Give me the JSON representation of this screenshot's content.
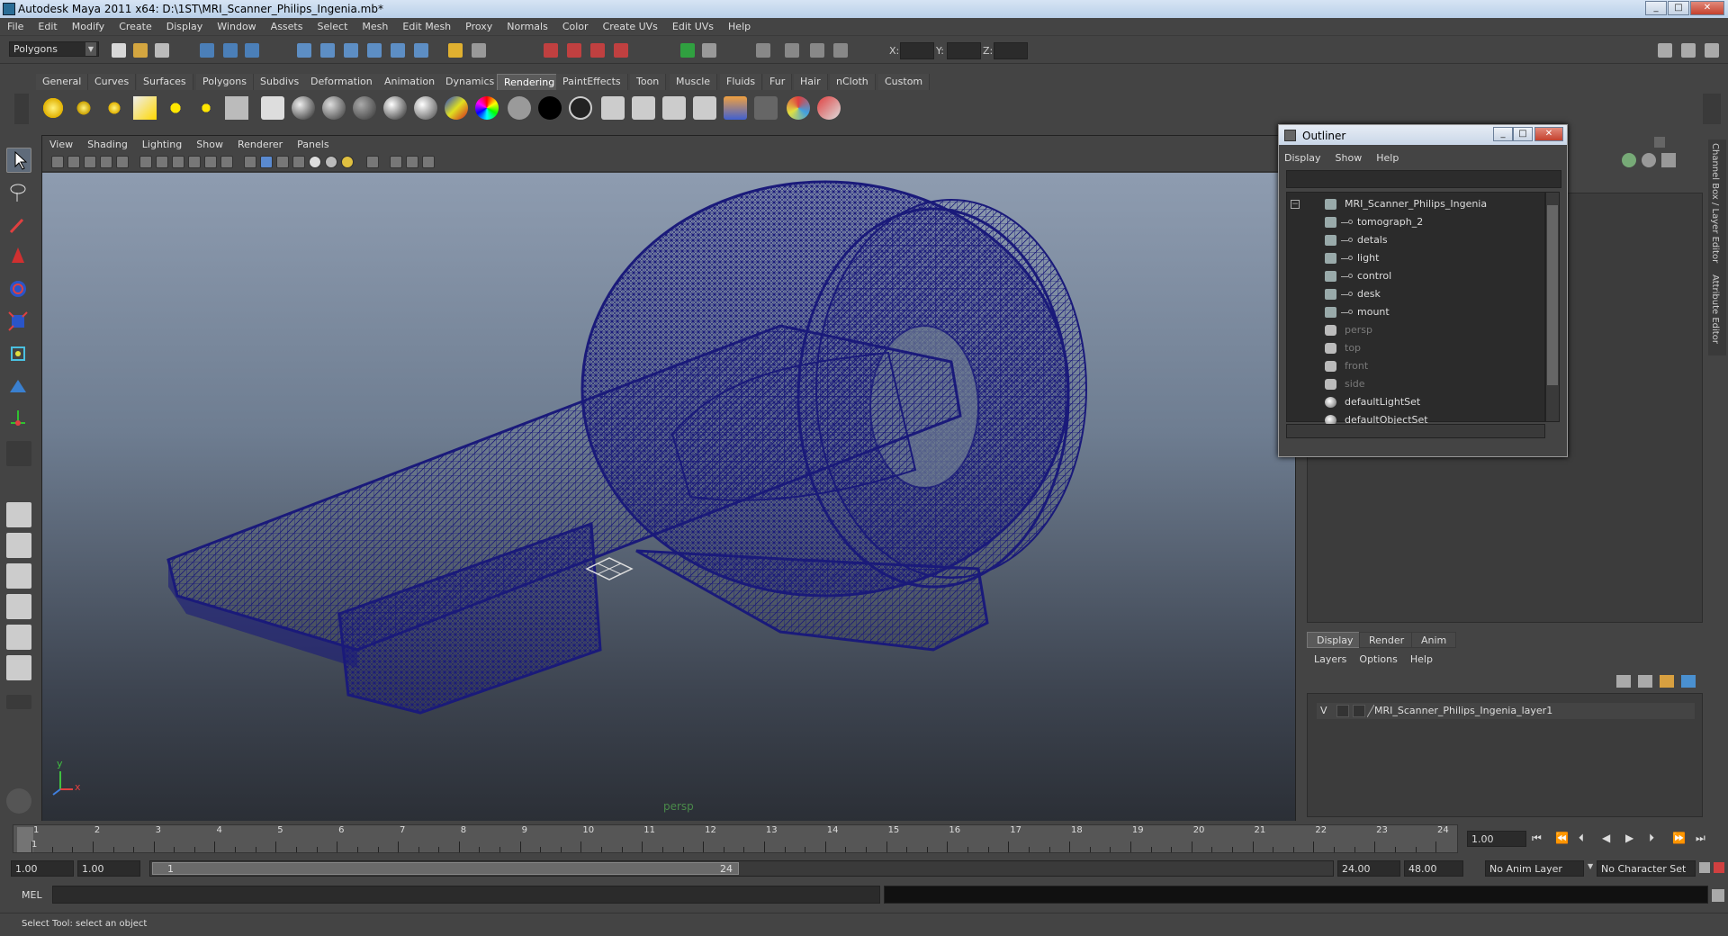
{
  "window": {
    "title": "Autodesk Maya 2011 x64: D:\\1ST\\MRI_Scanner_Philips_Ingenia.mb*"
  },
  "menubar": [
    "File",
    "Edit",
    "Modify",
    "Create",
    "Display",
    "Window",
    "Assets",
    "Select",
    "Mesh",
    "Edit Mesh",
    "Proxy",
    "Normals",
    "Color",
    "Create UVs",
    "Edit UVs",
    "Help"
  ],
  "statusline": {
    "menuset": "Polygons",
    "x_label": "X:",
    "y_label": "Y:",
    "z_label": "Z:"
  },
  "shelf": {
    "tabs": [
      "General",
      "Curves",
      "Surfaces",
      "Polygons",
      "Subdivs",
      "Deformation",
      "Animation",
      "Dynamics",
      "Rendering",
      "PaintEffects",
      "Toon",
      "Muscle",
      "Fluids",
      "Fur",
      "Hair",
      "nCloth",
      "Custom"
    ],
    "active_tab": "Rendering"
  },
  "viewport": {
    "menu": [
      "View",
      "Shading",
      "Lighting",
      "Show",
      "Renderer",
      "Panels"
    ],
    "camera_label": "persp",
    "axis_y": "y",
    "axis_x": "x",
    "wire_color": "#1a1a7a"
  },
  "outliner": {
    "title": "Outliner",
    "menu": [
      "Display",
      "Show",
      "Help"
    ],
    "items": [
      {
        "label": "MRI_Scanner_Philips_Ingenia",
        "indent": 0,
        "kind": "group",
        "dim": false
      },
      {
        "label": "tomograph_2",
        "indent": 1,
        "kind": "mesh",
        "dim": false
      },
      {
        "label": "detals",
        "indent": 1,
        "kind": "mesh",
        "dim": false
      },
      {
        "label": "light",
        "indent": 1,
        "kind": "mesh",
        "dim": false
      },
      {
        "label": "control",
        "indent": 1,
        "kind": "mesh",
        "dim": false
      },
      {
        "label": "desk",
        "indent": 1,
        "kind": "mesh",
        "dim": false
      },
      {
        "label": "mount",
        "indent": 1,
        "kind": "mesh",
        "dim": false
      },
      {
        "label": "persp",
        "indent": 0,
        "kind": "camera",
        "dim": true
      },
      {
        "label": "top",
        "indent": 0,
        "kind": "camera",
        "dim": true
      },
      {
        "label": "front",
        "indent": 0,
        "kind": "camera",
        "dim": true
      },
      {
        "label": "side",
        "indent": 0,
        "kind": "camera",
        "dim": true
      },
      {
        "label": "defaultLightSet",
        "indent": 0,
        "kind": "set",
        "dim": false
      },
      {
        "label": "defaultObjectSet",
        "indent": 0,
        "kind": "set",
        "dim": false
      }
    ]
  },
  "layer_editor": {
    "tabs": [
      "Display",
      "Render",
      "Anim"
    ],
    "active_tab": "Display",
    "menu": [
      "Layers",
      "Options",
      "Help"
    ],
    "layer": {
      "visible": "V",
      "name": "MRI_Scanner_Philips_Ingenia_layer1"
    }
  },
  "side_tabs": [
    "Channel Box / Layer Editor",
    "Attribute Editor"
  ],
  "timeline": {
    "frames": [
      "1",
      "2",
      "3",
      "4",
      "5",
      "6",
      "7",
      "8",
      "9",
      "10",
      "11",
      "12",
      "13",
      "14",
      "15",
      "16",
      "17",
      "18",
      "19",
      "20",
      "21",
      "22",
      "23",
      "24"
    ],
    "current_frame_marker": "1",
    "current_time": "1.00"
  },
  "range": {
    "start_time": "1.00",
    "playback_start": "1.00",
    "range_start_label": "1",
    "range_end_label": "24",
    "playback_end": "24.00",
    "end_time": "48.00",
    "anim_layer": "No Anim Layer",
    "character_set": "No Character Set"
  },
  "command": {
    "label": "MEL"
  },
  "helpline": {
    "text": "Select Tool: select an object"
  }
}
